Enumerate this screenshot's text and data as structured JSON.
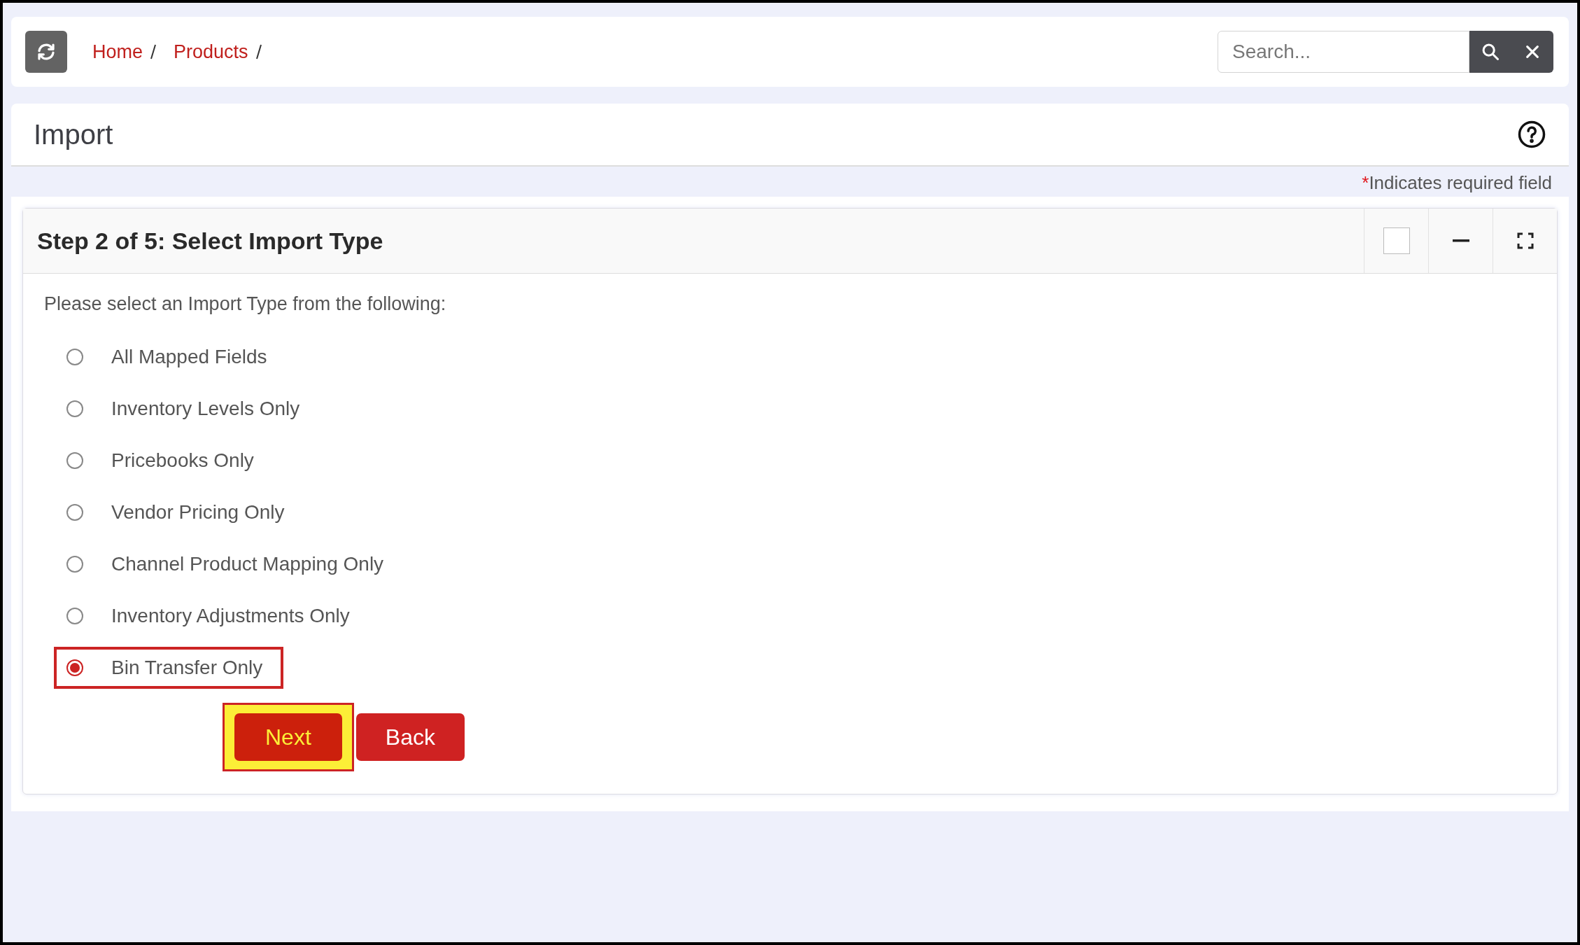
{
  "breadcrumbs": [
    {
      "label": "Home"
    },
    {
      "label": "Products"
    }
  ],
  "search": {
    "placeholder": "Search..."
  },
  "page": {
    "title": "Import"
  },
  "required_note": {
    "mark": "*",
    "text": "Indicates required field"
  },
  "panel": {
    "title": "Step 2 of 5: Select Import Type",
    "prompt": "Please select an Import Type from the following:",
    "options": [
      {
        "label": "All Mapped Fields",
        "selected": false
      },
      {
        "label": "Inventory Levels Only",
        "selected": false
      },
      {
        "label": "Pricebooks Only",
        "selected": false
      },
      {
        "label": "Vendor Pricing Only",
        "selected": false
      },
      {
        "label": "Channel Product Mapping Only",
        "selected": false
      },
      {
        "label": "Inventory Adjustments Only",
        "selected": false
      },
      {
        "label": "Bin Transfer Only",
        "selected": true
      }
    ],
    "buttons": [
      {
        "label": "Next",
        "highlighted": true
      },
      {
        "label": "Back",
        "highlighted": false
      }
    ]
  }
}
